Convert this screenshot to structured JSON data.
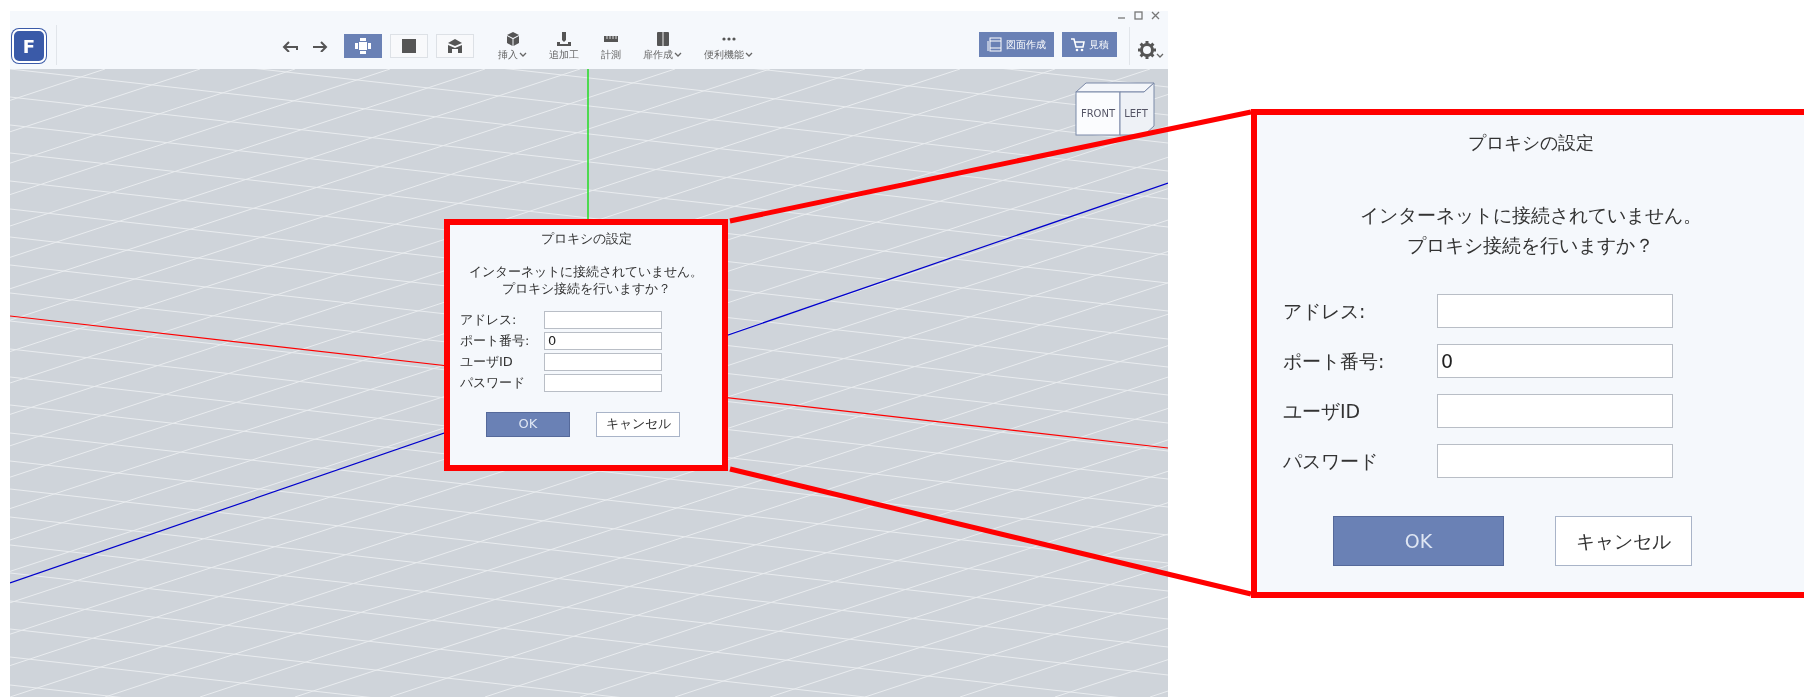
{
  "toolbar": {
    "logo": {
      "letter": "F"
    },
    "view_buttons": [
      {
        "selected": true
      },
      {
        "selected": false
      },
      {
        "selected": false
      }
    ],
    "tools": [
      {
        "label": "挿入",
        "dropdown": true
      },
      {
        "label": "追加工",
        "dropdown": false
      },
      {
        "label": "計測",
        "dropdown": false
      },
      {
        "label": "扉作成",
        "dropdown": true
      },
      {
        "label": "便利機能",
        "dropdown": true
      }
    ],
    "actions": [
      {
        "label": "図面作成"
      },
      {
        "label": "見積"
      }
    ]
  },
  "viewport": {
    "cube": {
      "faces": [
        "FRONT",
        "LEFT"
      ]
    },
    "dialog": {
      "title": "プロキシの設定",
      "message": [
        "インターネットに接続されていません。",
        "プロキシ接続を行いますか？"
      ],
      "fields": [
        {
          "label": "アドレス:"
        },
        {
          "label": "ポート番号:",
          "value": "0"
        },
        {
          "label": "ユーザID"
        },
        {
          "label": "パスワード"
        }
      ],
      "buttons": [
        {
          "label": "OK",
          "kind": "primary"
        },
        {
          "label": "キャンセル",
          "kind": "secondary"
        }
      ]
    }
  },
  "zoom_callout": {
    "dialog": {
      "title": "プロキシの設定",
      "message": [
        "インターネットに接続されていません。",
        "プロキシ接続を行いますか？"
      ],
      "fields": [
        {
          "label": "アドレス:"
        },
        {
          "label": "ポート番号:",
          "value": "0"
        },
        {
          "label": "ユーザID"
        },
        {
          "label": "パスワード"
        }
      ],
      "buttons": [
        {
          "label": "OK",
          "kind": "primary"
        },
        {
          "label": "キャンセル",
          "kind": "secondary"
        }
      ]
    }
  }
}
